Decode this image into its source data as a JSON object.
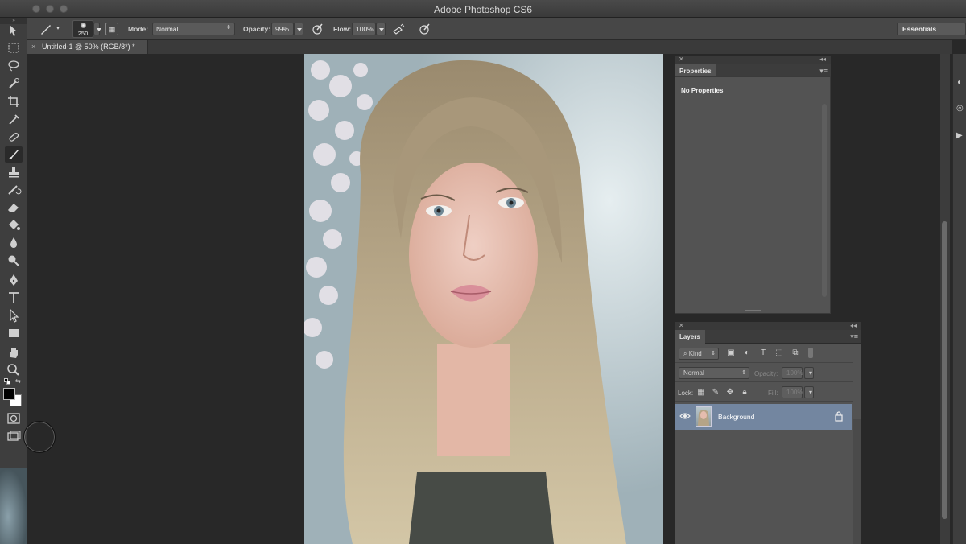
{
  "window": {
    "title": "Adobe Photoshop CS6"
  },
  "options_bar": {
    "brush_size": "250",
    "mode_label": "Mode:",
    "mode_value": "Normal",
    "opacity_label": "Opacity:",
    "opacity_value": "99%",
    "flow_label": "Flow:",
    "flow_value": "100%",
    "workspace": "Essentials"
  },
  "document": {
    "tab_label": "Untitled-1 @ 50% (RGB/8*) *",
    "tab_close": "×"
  },
  "properties_panel": {
    "tab": "Properties",
    "content": "No Properties"
  },
  "layers_panel": {
    "tab": "Layers",
    "filter": "Kind",
    "blend_mode": "Normal",
    "opacity_label": "Opacity:",
    "opacity_value": "100%",
    "lock_label": "Lock:",
    "fill_label": "Fill:",
    "fill_value": "100%",
    "layers": [
      {
        "name": "Background",
        "visible": true,
        "locked": true,
        "selected": true
      }
    ]
  },
  "tools": [
    "move-tool",
    "marquee-tool",
    "lasso-tool",
    "quick-selection-tool",
    "crop-tool",
    "eyedropper-tool",
    "healing-brush-tool",
    "brush-tool",
    "clone-stamp-tool",
    "history-brush-tool",
    "eraser-tool",
    "paint-bucket-tool",
    "blur-tool",
    "dodge-tool",
    "pen-tool",
    "type-tool",
    "path-selection-tool",
    "rectangle-tool",
    "hand-tool",
    "zoom-tool"
  ],
  "colors": {
    "foreground": "#000000",
    "background": "#ffffff",
    "selected_layer": "#7386a0"
  }
}
